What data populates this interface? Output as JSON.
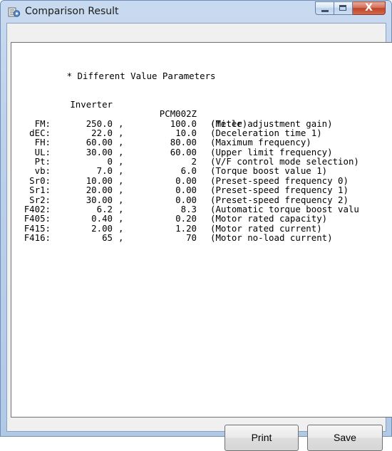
{
  "window": {
    "title": "Comparison Result",
    "icon": "app-settings-icon",
    "close_glyph": "X"
  },
  "report": {
    "heading": "* Different Value Parameters",
    "columns": {
      "inverter": "Inverter",
      "pcm": "PCM002Z",
      "description": "(Title)"
    },
    "rows": [
      {
        "name": "FM:",
        "inverter": "250.0",
        "pcm": "100.0",
        "desc": "(Meter adjustment gain)"
      },
      {
        "name": "dEC:",
        "inverter": "22.0",
        "pcm": "10.0",
        "desc": "(Deceleration time 1)"
      },
      {
        "name": "FH:",
        "inverter": "60.00",
        "pcm": "80.00",
        "desc": "(Maximum frequency)"
      },
      {
        "name": "UL:",
        "inverter": "30.00",
        "pcm": "60.00",
        "desc": "(Upper limit frequency)"
      },
      {
        "name": "Pt:",
        "inverter": "0",
        "pcm": "2",
        "desc": "(V/F control mode selection)"
      },
      {
        "name": "vb:",
        "inverter": "7.0",
        "pcm": "6.0",
        "desc": "(Torque boost value 1)"
      },
      {
        "name": "Sr0:",
        "inverter": "10.00",
        "pcm": "0.00",
        "desc": "(Preset-speed frequency 0)"
      },
      {
        "name": "Sr1:",
        "inverter": "20.00",
        "pcm": "0.00",
        "desc": "(Preset-speed frequency 1)"
      },
      {
        "name": "Sr2:",
        "inverter": "30.00",
        "pcm": "0.00",
        "desc": "(Preset-speed frequency 2)"
      },
      {
        "name": "F402:",
        "inverter": "6.2",
        "pcm": "8.3",
        "desc": "(Automatic torque boost valu"
      },
      {
        "name": "F405:",
        "inverter": "0.40",
        "pcm": "0.20",
        "desc": "(Motor rated capacity)"
      },
      {
        "name": "F415:",
        "inverter": "2.00",
        "pcm": "1.20",
        "desc": "(Motor rated current)"
      },
      {
        "name": "F416:",
        "inverter": "65",
        "pcm": "70",
        "desc": "(Motor no-load current)"
      }
    ],
    "separator": ","
  },
  "buttons": {
    "print": "Print",
    "save": "Save"
  },
  "colors": {
    "close_button": "#c2432a",
    "frame": "#b2c9e6",
    "client": "#f0f0f0"
  }
}
